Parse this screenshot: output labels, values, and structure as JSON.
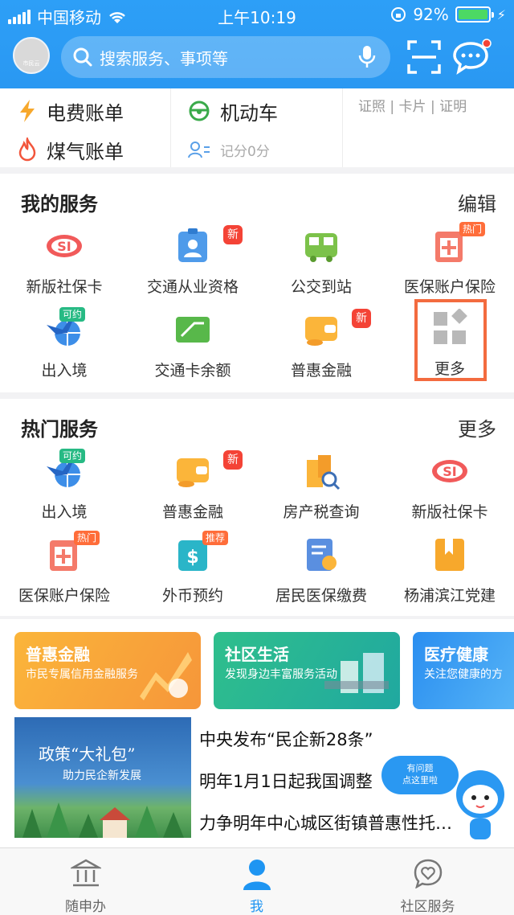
{
  "status_bar": {
    "carrier": "中国移动",
    "time": "上午10:19",
    "battery": "92%"
  },
  "header": {
    "search_placeholder": "搜索服务、事项等",
    "avatar_text": "市民云"
  },
  "quick": {
    "electric_bill": "电费账单",
    "gas_bill": "煤气账单",
    "vehicle": "机动车",
    "score": "记分0分",
    "cards": "证照 | 卡片 | 证明"
  },
  "my_services": {
    "title": "我的服务",
    "edit": "编辑",
    "items": [
      {
        "label": "新版社保卡",
        "icon": "social-security-icon"
      },
      {
        "label": "交通从业资格",
        "icon": "id-badge-icon",
        "badge": "新"
      },
      {
        "label": "公交到站",
        "icon": "bus-icon"
      },
      {
        "label": "医保账户保险",
        "icon": "medical-insurance-icon",
        "badge": "热门"
      },
      {
        "label": "出入境",
        "icon": "plane-globe-icon",
        "badge": "可约"
      },
      {
        "label": "交通卡余额",
        "icon": "transport-card-icon"
      },
      {
        "label": "普惠金融",
        "icon": "wallet-icon",
        "badge": "新"
      },
      {
        "label": "更多",
        "icon": "more-grid-icon"
      }
    ]
  },
  "hot_services": {
    "title": "热门服务",
    "more": "更多",
    "items": [
      {
        "label": "出入境",
        "icon": "plane-globe-icon",
        "badge": "可约"
      },
      {
        "label": "普惠金融",
        "icon": "wallet-icon",
        "badge": "新"
      },
      {
        "label": "房产税查询",
        "icon": "building-search-icon"
      },
      {
        "label": "新版社保卡",
        "icon": "social-security-icon"
      },
      {
        "label": "医保账户保险",
        "icon": "medical-insurance-icon",
        "badge": "热门"
      },
      {
        "label": "外币预约",
        "icon": "currency-icon",
        "badge": "推荐"
      },
      {
        "label": "居民医保缴费",
        "icon": "payment-doc-icon"
      },
      {
        "label": "杨浦滨江党建",
        "icon": "party-building-icon"
      }
    ]
  },
  "banners": [
    {
      "title": "普惠金融",
      "subtitle": "市民专属信用金融服务",
      "color": "#fbb53a"
    },
    {
      "title": "社区生活",
      "subtitle": "发现身边丰富服务活动",
      "color": "#2fbf8c"
    },
    {
      "title": "医疗健康",
      "subtitle": "关注您健康的方",
      "color": "#2a8ef0"
    }
  ],
  "news": {
    "image_text_1": "政策“大礼包”",
    "image_text_2": "助力民企新发展",
    "lines": [
      "中央发布“民企新28条”",
      "明年1月1日起我国调整",
      "力争明年中心城区街镇普惠性托…"
    ],
    "mascot_text_1": "有问题",
    "mascot_text_2": "点这里啦"
  },
  "tabbar": [
    {
      "label": "随申办",
      "icon": "building-icon"
    },
    {
      "label": "我",
      "icon": "person-icon"
    },
    {
      "label": "社区服务",
      "icon": "heart-chat-icon"
    }
  ],
  "colors": {
    "primary": "#2a98f2",
    "badge_red": "#f44336",
    "badge_orange": "#ff6d3a",
    "highlight": "#f36b3f"
  }
}
